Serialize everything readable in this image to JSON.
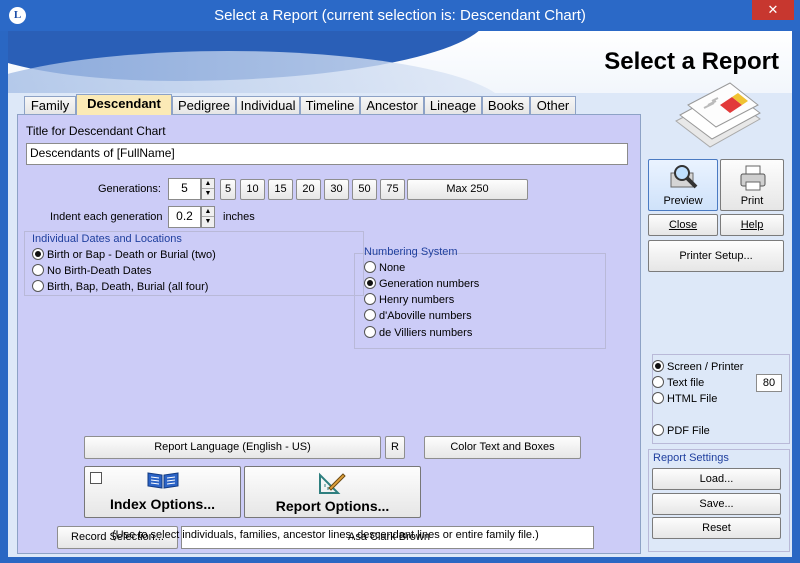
{
  "window": {
    "title": "Select a Report  (current selection is: Descendant Chart)",
    "close_glyph": "✕",
    "app_icon_letter": "L"
  },
  "banner": {
    "title": "Select a Report"
  },
  "tabs": [
    {
      "label": "Family",
      "active": false
    },
    {
      "label": "Descendant",
      "active": true
    },
    {
      "label": "Pedigree",
      "active": false
    },
    {
      "label": "Individual",
      "active": false
    },
    {
      "label": "Timeline",
      "active": false
    },
    {
      "label": "Ancestor",
      "active": false
    },
    {
      "label": "Lineage",
      "active": false
    },
    {
      "label": "Books",
      "active": false
    },
    {
      "label": "Other",
      "active": false
    }
  ],
  "form": {
    "title_label": "Title for Descendant Chart",
    "title_value": "Descendants of [FullName]",
    "generations_label": "Generations:",
    "generations_value": "5",
    "generation_presets": [
      "5",
      "10",
      "15",
      "20",
      "30",
      "50",
      "75"
    ],
    "max_button": "Max 250",
    "indent_label": "Indent each generation",
    "indent_value": "0.2",
    "indent_unit": "inches",
    "spin_up": "▲",
    "spin_down": "▼"
  },
  "dates_group": {
    "title": "Individual Dates and Locations",
    "options": [
      {
        "label": "Birth or Bap - Death or Burial (two)",
        "selected": true
      },
      {
        "label": "No Birth-Death Dates",
        "selected": false
      },
      {
        "label": "Birth, Bap, Death, Burial (all four)",
        "selected": false
      }
    ]
  },
  "numbering_group": {
    "title": "Numbering System",
    "options": [
      {
        "label": "None",
        "selected": false
      },
      {
        "label": "Generation numbers",
        "selected": true
      },
      {
        "label": "Henry numbers",
        "selected": false
      },
      {
        "label": "d'Aboville numbers",
        "selected": false
      },
      {
        "label": "de Villiers numbers",
        "selected": false
      }
    ]
  },
  "bottom": {
    "report_language": "Report Language (English - US)",
    "r_button": "R",
    "color_button": "Color Text and Boxes",
    "index_options": "Index Options...",
    "report_options": "Report Options...",
    "record_selection": "Record Selection...",
    "record_value": "Asa Clark Brown",
    "hint": "(Use to select individuals, families, ancestor lines, descendant lines or entire family file.)"
  },
  "actions": {
    "preview": "Preview",
    "print": "Print",
    "close": "Close",
    "help": "Help",
    "printer_setup": "Printer Setup..."
  },
  "output": {
    "options": [
      {
        "label": "Screen / Printer",
        "selected": true
      },
      {
        "label": "Text file",
        "selected": false
      },
      {
        "label": "HTML File",
        "selected": false
      },
      {
        "label": "PDF File",
        "selected": false
      }
    ],
    "text_width": "80"
  },
  "report_settings": {
    "title": "Report Settings",
    "load": "Load...",
    "save": "Save...",
    "reset": "Reset"
  },
  "colors": {
    "panel": "#ccccf7",
    "active_tab": "#fbeab6",
    "titlebar": "#2b69c7",
    "close": "#c7372f"
  }
}
